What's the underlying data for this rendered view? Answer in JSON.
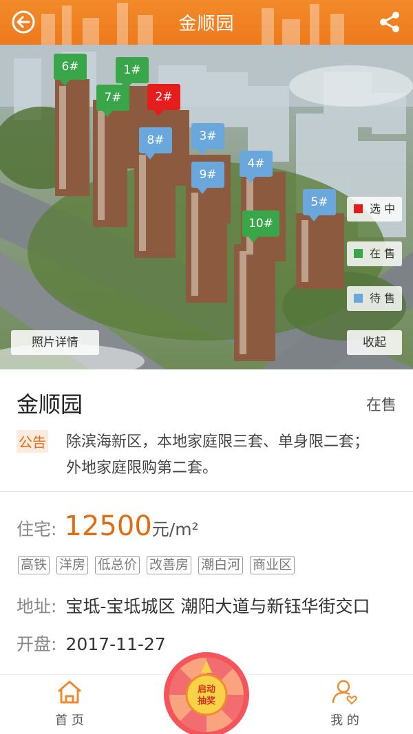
{
  "header": {
    "title": "金顺园",
    "back_icon": "back-arrow-icon",
    "share_icon": "share-icon"
  },
  "hero": {
    "buildings": [
      {
        "label": "6#",
        "status": "在售"
      },
      {
        "label": "1#",
        "status": "在售"
      },
      {
        "label": "7#",
        "status": "在售"
      },
      {
        "label": "2#",
        "status": "选中"
      },
      {
        "label": "8#",
        "status": "待售"
      },
      {
        "label": "3#",
        "status": "待售"
      },
      {
        "label": "9#",
        "status": "待售"
      },
      {
        "label": "4#",
        "status": "待售"
      },
      {
        "label": "5#",
        "status": "待售"
      },
      {
        "label": "10#",
        "status": "在售"
      }
    ],
    "legend": [
      {
        "label": "选 中",
        "color": "#e51d1d"
      },
      {
        "label": "在 售",
        "color": "#3aa64a"
      },
      {
        "label": "待 售",
        "color": "#6aa7dc"
      }
    ],
    "photo_button": "照片详情",
    "collapse_button": "收起"
  },
  "project": {
    "name": "金顺园",
    "status": "在售",
    "notice_label": "公告",
    "notice_text": "除滨海新区，本地家庭限三套、单身限二套；外地家庭限购第二套。",
    "price_label": "住宅:",
    "price_value": "12500",
    "price_unit": "元/m²",
    "tags": [
      "高铁",
      "洋房",
      "低总价",
      "改善房",
      "潮白河",
      "商业区"
    ],
    "address_label": "地址:",
    "address_value": "宝坻-宝坻城区 潮阳大道与新钰华街交口",
    "open_label": "开盘:",
    "open_value": "2017-11-27"
  },
  "nav": {
    "home_label": "首 页",
    "mine_label": "我 的",
    "lottery_label_line1": "启动",
    "lottery_label_line2": "抽奖"
  },
  "colors": {
    "accent": "#ee7a1c",
    "selected": "#e51d1d",
    "on_sale": "#3aa64a",
    "pending": "#6aa7dc"
  }
}
